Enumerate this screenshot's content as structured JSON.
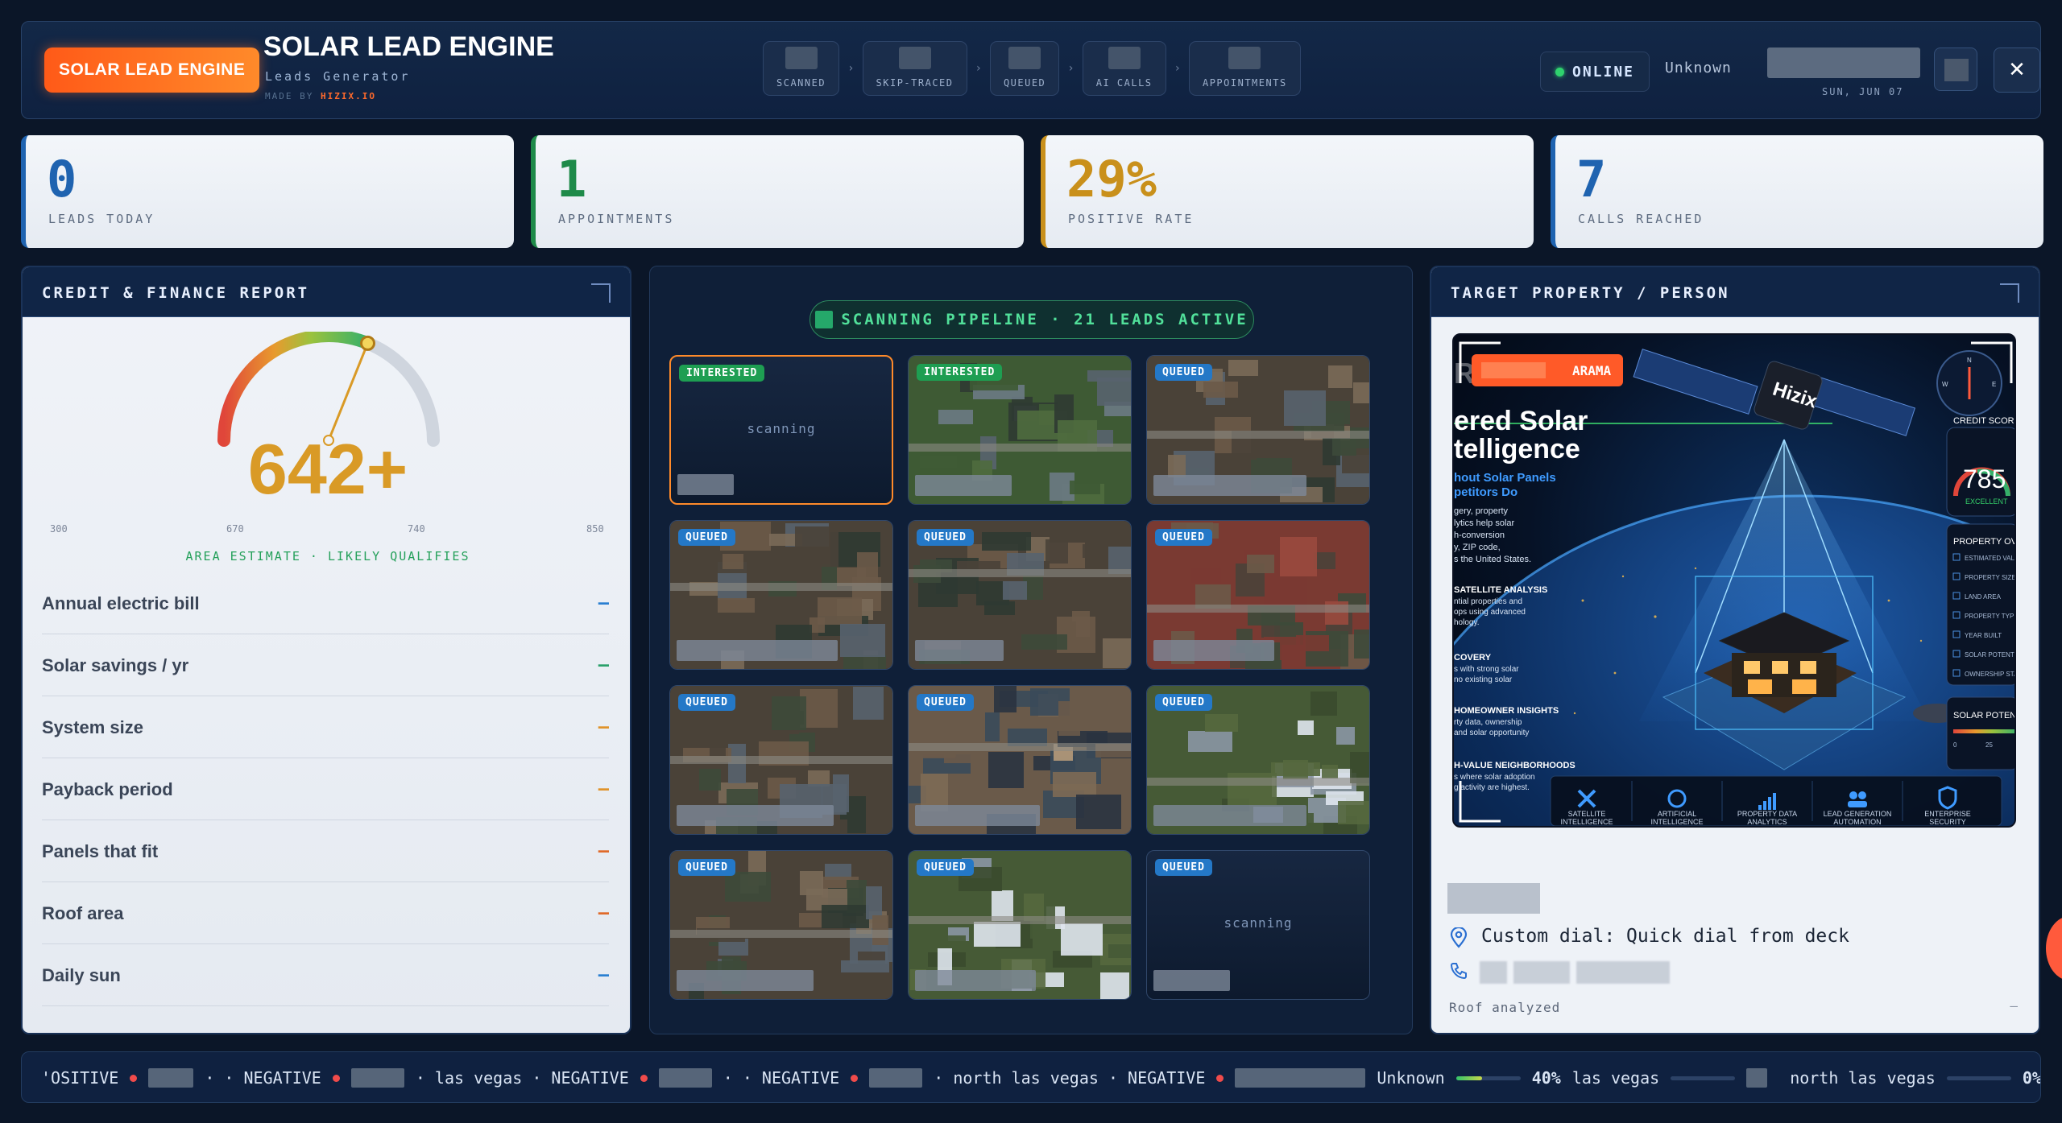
{
  "header": {
    "brand_badge": "SOLAR LEAD ENGINE",
    "title": "SOLAR LEAD ENGINE",
    "subtitle": "Leads Generator",
    "made_by_prefix": "MADE BY",
    "made_by_name": "HIZIX.IO",
    "pipeline_steps": [
      "SCANNED",
      "SKIP-TRACED",
      "QUEUED",
      "AI CALLS",
      "APPOINTMENTS"
    ],
    "status": "ONLINE",
    "user_name": "Unknown",
    "date": "SUN, JUN 07",
    "close_label": "✕"
  },
  "stats": [
    {
      "value": "0",
      "label": "LEADS TODAY",
      "color": "#1f63b0"
    },
    {
      "value": "1",
      "label": "APPOINTMENTS",
      "color": "#1e8a49"
    },
    {
      "value": "29%",
      "label": "POSITIVE RATE",
      "color": "#c9901b"
    },
    {
      "value": "7",
      "label": "CALLS REACHED",
      "color": "#1f63b0"
    }
  ],
  "credit": {
    "title": "CREDIT & FINANCE REPORT",
    "score": "642+",
    "score_value": 642,
    "range_min": 300,
    "range_max": 850,
    "ticks": [
      "300",
      "670",
      "740",
      "850"
    ],
    "note": "AREA ESTIMATE · LIKELY QUALIFIES",
    "rows": [
      {
        "label": "Annual electric bill",
        "value": "—",
        "color": "#2a7fd1"
      },
      {
        "label": "Solar savings / yr",
        "value": "—",
        "color": "#2aa06a"
      },
      {
        "label": "System size",
        "value": "—",
        "color": "#e0932a"
      },
      {
        "label": "Payback period",
        "value": "—",
        "color": "#e0932a"
      },
      {
        "label": "Panels that fit",
        "value": "—",
        "color": "#e06a2a"
      },
      {
        "label": "Roof area",
        "value": "—",
        "color": "#e06a2a"
      },
      {
        "label": "Daily sun",
        "value": "—",
        "color": "#2a7fd1"
      }
    ]
  },
  "pipeline": {
    "title": "SCANNING PIPELINE · 21 LEADS ACTIVE",
    "tiles": [
      {
        "status": "INTERESTED",
        "scanning": "scanning",
        "theme": "scan"
      },
      {
        "status": "INTERESTED",
        "scanning": "",
        "theme": "green"
      },
      {
        "status": "QUEUED",
        "scanning": "",
        "theme": "dense"
      },
      {
        "status": "QUEUED",
        "scanning": "",
        "theme": "dense"
      },
      {
        "status": "QUEUED",
        "scanning": "",
        "theme": "dense"
      },
      {
        "status": "QUEUED",
        "scanning": "",
        "theme": "red"
      },
      {
        "status": "QUEUED",
        "scanning": "",
        "theme": "dense"
      },
      {
        "status": "QUEUED",
        "scanning": "",
        "theme": "lot"
      },
      {
        "status": "QUEUED",
        "scanning": "",
        "theme": "field"
      },
      {
        "status": "QUEUED",
        "scanning": "",
        "theme": "dense"
      },
      {
        "status": "QUEUED",
        "scanning": "",
        "theme": "field"
      },
      {
        "status": "QUEUED",
        "scanning": "scanning",
        "theme": "scan"
      }
    ]
  },
  "target": {
    "title": "TARGET PROPERTY / PERSON",
    "promo": {
      "tag": "ARAMA",
      "logo": "Hizix",
      "headline_1": "ered Solar",
      "headline_2": "telligence",
      "sub_1": "hout Solar Panels",
      "sub_2": "petitors Do",
      "body": [
        "gery, property",
        "lytics help solar",
        "h-conversion",
        "y, ZIP code,",
        "s the United States."
      ],
      "sections": [
        {
          "title": "SATELLITE ANALYSIS",
          "lines": [
            "ntial properties and",
            "ops using advanced",
            "hology."
          ]
        },
        {
          "title": "COVERY",
          "lines": [
            "s with strong solar",
            "no existing solar"
          ]
        },
        {
          "title": "HOMEOWNER INSIGHTS",
          "lines": [
            "rty data, ownership",
            "and solar opportunity"
          ]
        },
        {
          "title": "H-VALUE NEIGHBORHOODS",
          "lines": [
            "s where solar adoption",
            "g activity are highest."
          ]
        }
      ],
      "credit_label": "CREDIT SCORE",
      "credit_value": "785",
      "credit_grade": "EXCELLENT",
      "overview_title": "PROPERTY OVE",
      "overview_items": [
        "ESTIMATED VALU",
        "PROPERTY SIZE",
        "LAND AREA",
        "PROPERTY TYPE",
        "YEAR BUILT",
        "SOLAR POTENTI",
        "OWNERSHIP STA"
      ],
      "potential_title": "SOLAR POTENTI",
      "potential_scale": [
        "0",
        "25"
      ],
      "features": [
        {
          "icon": "satellite-icon",
          "label_1": "SATELLITE",
          "label_2": "INTELLIGENCE"
        },
        {
          "icon": "brain-icon",
          "label_1": "ARTIFICIAL",
          "label_2": "INTELLIGENCE"
        },
        {
          "icon": "bar-chart-icon",
          "label_1": "PROPERTY DATA",
          "label_2": "ANALYTICS"
        },
        {
          "icon": "users-icon",
          "label_1": "LEAD GENERATION",
          "label_2": "AUTOMATION"
        },
        {
          "icon": "shield-icon",
          "label_1": "ENTERPRISE",
          "label_2": "SECURITY"
        }
      ]
    },
    "custom_dial": "Custom dial: Quick dial from deck",
    "roof_label": "Roof analyzed",
    "roof_value": "—"
  },
  "ticker": {
    "items": [
      {
        "type": "text",
        "text": "'OSITIVE"
      },
      {
        "type": "sep",
        "text": "· · NEGATIVE"
      },
      {
        "type": "sep",
        "text": "· las vegas · NEGATIVE"
      },
      {
        "type": "sep",
        "text": "· · NEGATIVE"
      },
      {
        "type": "sep",
        "text": "· north las vegas · NEGATIVE"
      }
    ],
    "cities": [
      {
        "name": "Unknown",
        "pct": "40%",
        "value": 0.4
      },
      {
        "name": "las vegas",
        "pct": "",
        "value": 0.0
      },
      {
        "name": "north las vegas",
        "pct": "0%",
        "value": 0.0
      }
    ]
  }
}
